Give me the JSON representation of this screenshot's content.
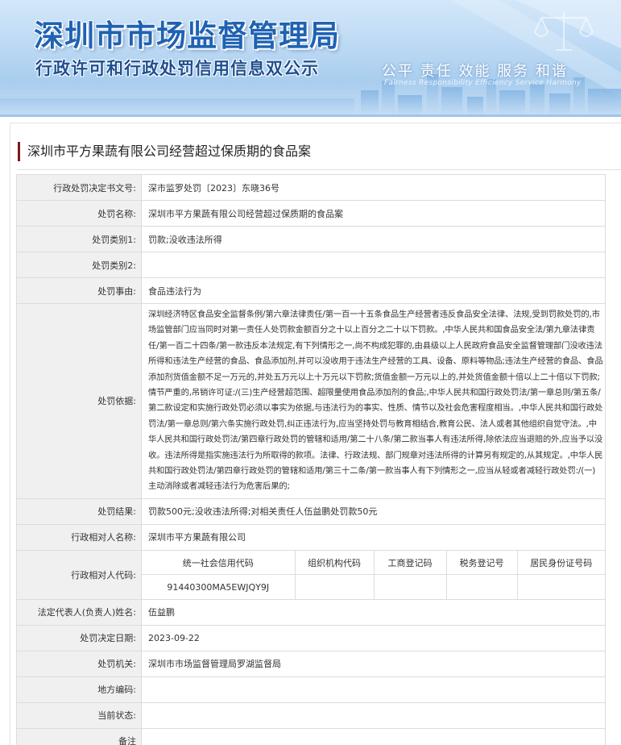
{
  "header": {
    "title": "深圳市市场监督管理局",
    "subtitle": "行政许可和行政处罚信用信息双公示",
    "slogan": "公平  责任  效能  服务  和谐",
    "slogan_en": "Fairness  Responsibility  Efficiency  Service  Harmony"
  },
  "case_title": "深圳市平方果蔬有限公司经营超过保质期的食品案",
  "rows": [
    {
      "label": "行政处罚决定书文号:",
      "value": "深市监罗处罚〔2023〕东晓36号"
    },
    {
      "label": "处罚名称:",
      "value": "深圳市平方果蔬有限公司经营超过保质期的食品案"
    },
    {
      "label": "处罚类别1:",
      "value": "罚款;没收违法所得"
    },
    {
      "label": "处罚类别2:",
      "value": ""
    },
    {
      "label": "处罚事由:",
      "value": "食品违法行为"
    },
    {
      "label": "处罚依据:",
      "value": "深圳经济特区食品安全监督条例/第六章法律责任/第一百一十五条食品生产经营者违反食品安全法律、法规,受到罚款处罚的,市场监管部门应当同时对第一责任人处罚款金额百分之十以上百分之二十以下罚款。,中华人民共和国食品安全法/第九章法律责任/第一百二十四条/第一款违反本法规定,有下列情形之一,尚不构成犯罪的,由县级以上人民政府食品安全监督管理部门没收违法所得和违法生产经营的食品、食品添加剂,并可以没收用于违法生产经营的工具、设备、原料等物品;违法生产经营的食品、食品添加剂货值金额不足一万元的,并处五万元以上十万元以下罚款;货值金额一万元以上的,并处货值金额十倍以上二十倍以下罚款;情节严重的,吊销许可证:/(三)生产经营超范围、超限量使用食品添加剂的食品;,中华人民共和国行政处罚法/第一章总则/第五条/第二款设定和实施行政处罚必须以事实为依据,与违法行为的事实、性质、情节以及社会危害程度相当。,中华人民共和国行政处罚法/第一章总则/第六条实施行政处罚,纠正违法行为,应当坚持处罚与教育相结合,教育公民、法人或者其他组织自觉守法。,中华人民共和国行政处罚法/第四章行政处罚的管辖和适用/第二十八条/第二款当事人有违法所得,除依法应当退赔的外,应当予以没收。违法所得是指实施违法行为所取得的款项。法律、行政法规、部门规章对违法所得的计算另有规定的,从其规定。,中华人民共和国行政处罚法/第四章行政处罚的管辖和适用/第三十二条/第一款当事人有下列情形之一,应当从轻或者减轻行政处罚:/(一)主动消除或者减轻违法行为危害后果的;"
    },
    {
      "label": "处罚结果:",
      "value": "罚款500元;没收违法所得;对相关责任人伍益鹏处罚款50元"
    },
    {
      "label": "行政相对人名称:",
      "value": "深圳市平方果蔬有限公司"
    }
  ],
  "codes": {
    "label": "行政相对人代码:",
    "headers": [
      "统一社会信用代码",
      "组织机构代码",
      "工商登记码",
      "税务登记号",
      "居民身份证号码"
    ],
    "values": [
      "91440300MA5EWJQY9J",
      "",
      "",
      "",
      ""
    ]
  },
  "rows2": [
    {
      "label": "法定代表人(负责人)姓名:",
      "value": "伍益鹏"
    },
    {
      "label": "处罚决定日期:",
      "value": "2023-09-22"
    },
    {
      "label": "处罚机关:",
      "value": "深圳市市场监督管理局罗湖监督局"
    },
    {
      "label": "地方编码:",
      "value": ""
    },
    {
      "label": "当前状态:",
      "value": ""
    },
    {
      "label": "备注",
      "value": ""
    }
  ]
}
